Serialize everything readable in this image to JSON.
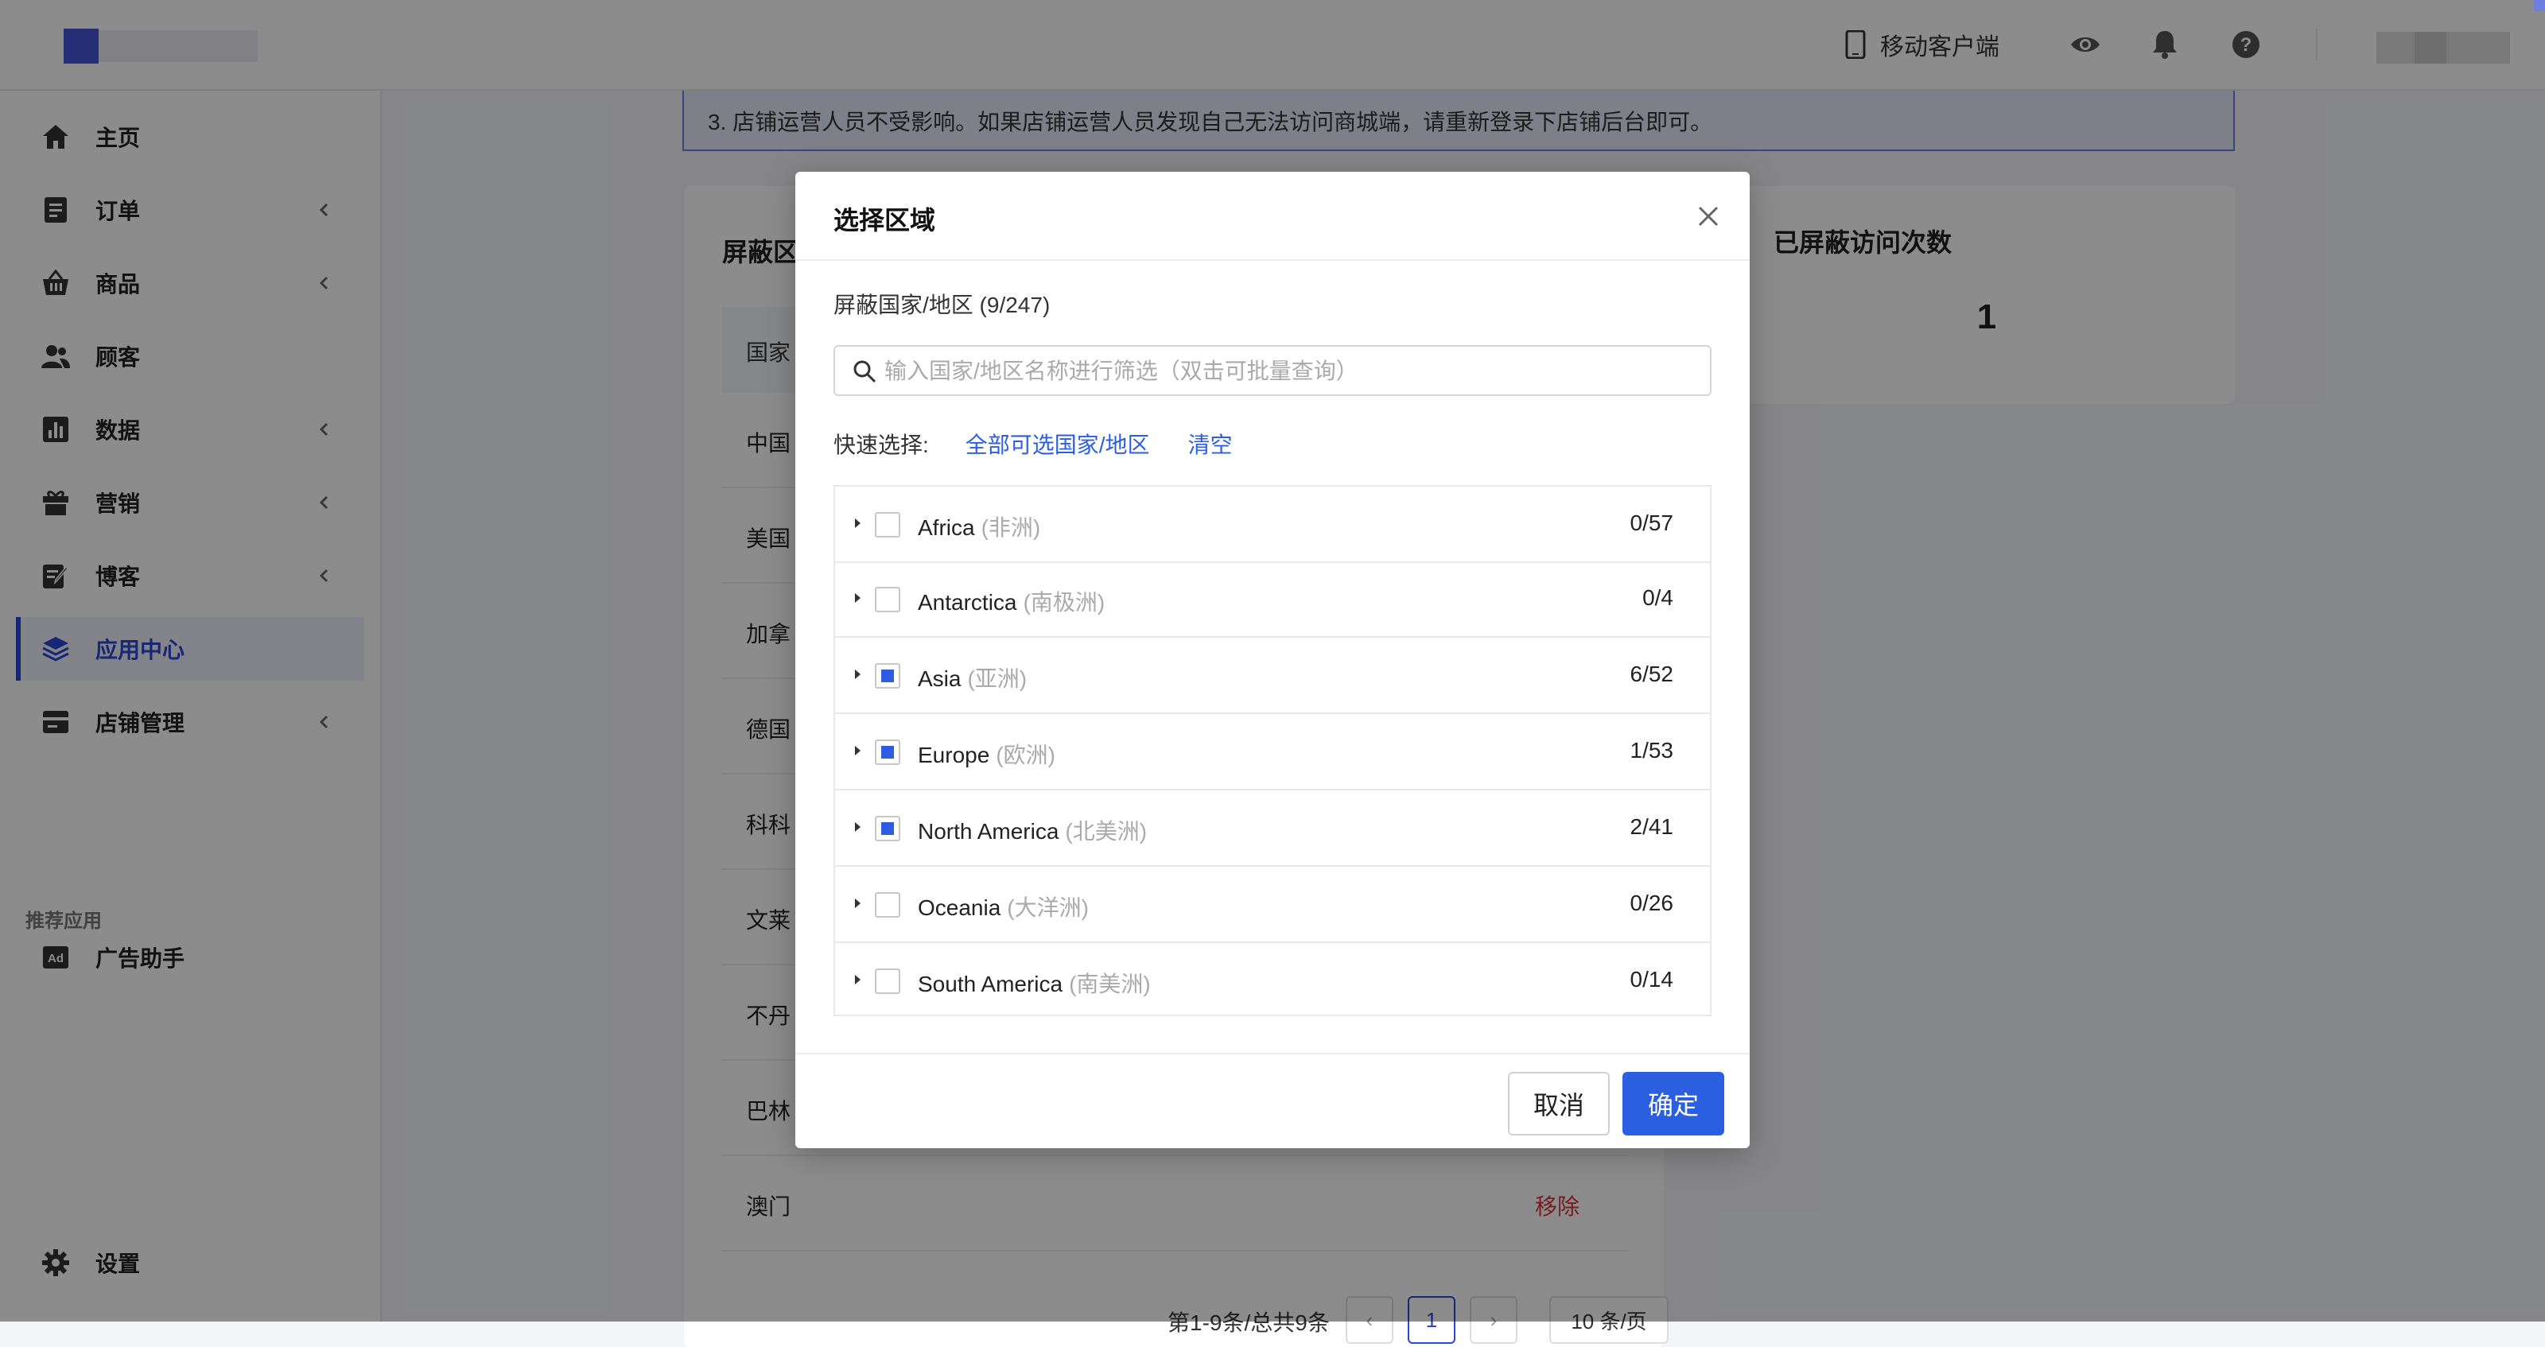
{
  "header": {
    "mobile_label": "移动客户端",
    "icons": [
      "eye-icon",
      "bell-icon",
      "help-icon"
    ]
  },
  "sidebar": {
    "items": [
      {
        "label": "主页",
        "icon": "home-icon",
        "has_children": false
      },
      {
        "label": "订单",
        "icon": "order-icon",
        "has_children": true
      },
      {
        "label": "商品",
        "icon": "basket-icon",
        "has_children": true
      },
      {
        "label": "顾客",
        "icon": "users-icon",
        "has_children": false
      },
      {
        "label": "数据",
        "icon": "chart-icon",
        "has_children": true
      },
      {
        "label": "营销",
        "icon": "gift-icon",
        "has_children": true
      },
      {
        "label": "博客",
        "icon": "edit-icon",
        "has_children": true
      },
      {
        "label": "应用中心",
        "icon": "layers-icon",
        "has_children": false,
        "active": true
      },
      {
        "label": "店铺管理",
        "icon": "store-icon",
        "has_children": true
      }
    ],
    "section_label": "推荐应用",
    "recommended": [
      {
        "label": "广告助手",
        "icon": "ad-icon"
      }
    ],
    "settings_label": "设置"
  },
  "notice": {
    "text": "3. 店铺运营人员不受影响。如果店铺运营人员发现自己无法访问商城端，请重新登录下店铺后台即可。"
  },
  "blocked_panel": {
    "title": "屏蔽区",
    "column_header": "国家",
    "rows": [
      "中国",
      "美国",
      "加拿",
      "德国",
      "科科",
      "文莱",
      "不丹",
      "巴林",
      "澳门"
    ],
    "remove_label": "移除",
    "pagination": {
      "summary": "第1-9条/总共9条",
      "prev": "‹",
      "current_page": "1",
      "next": "›",
      "page_size": "10 条/页"
    }
  },
  "stats_panel": {
    "title": "已屏蔽访问次数",
    "value": "1"
  },
  "modal": {
    "title": "选择区域",
    "count_label": "屏蔽国家/地区 (9/247)",
    "search_placeholder": "输入国家/地区名称进行筛选（双击可批量查询）",
    "quick_select_label": "快速选择:",
    "quick_all": "全部可选国家/地区",
    "quick_clear": "清空",
    "regions": [
      {
        "name": "Africa",
        "zh": "(非洲)",
        "count": "0/57",
        "state": "none"
      },
      {
        "name": "Antarctica",
        "zh": "(南极洲)",
        "count": "0/4",
        "state": "none"
      },
      {
        "name": "Asia",
        "zh": "(亚洲)",
        "count": "6/52",
        "state": "partial"
      },
      {
        "name": "Europe",
        "zh": "(欧洲)",
        "count": "1/53",
        "state": "partial"
      },
      {
        "name": "North America",
        "zh": "(北美洲)",
        "count": "2/41",
        "state": "partial"
      },
      {
        "name": "Oceania",
        "zh": "(大洋洲)",
        "count": "0/26",
        "state": "none"
      },
      {
        "name": "South America",
        "zh": "(南美洲)",
        "count": "0/14",
        "state": "none"
      }
    ],
    "cancel_label": "取消",
    "ok_label": "确定"
  },
  "colors": {
    "primary": "#2b5fe0",
    "sidebar_active": "#2b48d6",
    "danger": "#d9363e",
    "overlay": "rgba(0,0,0,0.45)"
  }
}
